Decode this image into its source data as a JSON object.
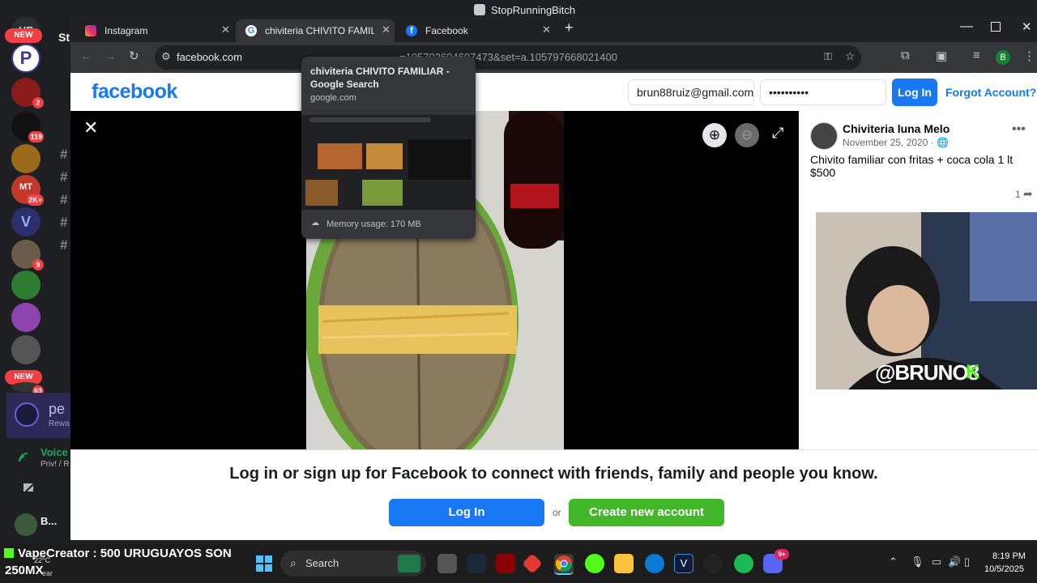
{
  "discord": {
    "badges": {
      "b2": "2",
      "b119": "119",
      "b2k": "2K+",
      "b9": "9",
      "b63": "63"
    },
    "new_pill": "NEW",
    "server_header_partial": "St",
    "channels": [
      "#",
      "#",
      "#",
      "#",
      "#"
    ],
    "panel_app_partial": "pe",
    "panel_rewards_partial": "Rewa",
    "voice_label": "Voice",
    "voice_sub": "Priv! / R",
    "user_name_partial": "B..."
  },
  "window": {
    "title": "StopRunningBitch"
  },
  "tabs": [
    {
      "label": "Instagram",
      "active": false
    },
    {
      "label": "chiviteria CHIVITO FAMILIAR - G",
      "active": true
    },
    {
      "label": "Facebook",
      "active": false
    }
  ],
  "address": {
    "host": "facebook.com",
    "path_partial": "=105703604697473&set=a.105797668021400"
  },
  "hover_card": {
    "title": "chiviteria CHIVITO FAMILIAR - Google Search",
    "domain": "google.com",
    "memory": "Memory usage: 170 MB"
  },
  "profile_initial": "B",
  "facebook": {
    "logo": "facebook",
    "email_value": "brun88ruiz@gmail.com",
    "password_value": "••••••••••",
    "login_label": "Log In",
    "forgot_label": "Forgot Account?",
    "post": {
      "author": "Chiviteria luna Melo",
      "date": "November 25, 2020 · ",
      "text": "Chivito familiar con fritas + coca cola 1 lt $500",
      "share_count": "1"
    },
    "banner_text": "Log in or sign up for Facebook to connect with friends, family and people you know.",
    "banner_login": "Log In",
    "banner_or": "or",
    "banner_create": "Create new account"
  },
  "stream": {
    "overlay_handle": "@BRUNO8",
    "ticker": "VapeCreator : 500 URUGUAYOS SON",
    "ticker_2": "250MX",
    "weather_temp": "22°C",
    "weather_sub": "ear"
  },
  "taskbar": {
    "search_label": "Search",
    "time": "8:19 PM",
    "date": "10/5/2025",
    "discord_badge": "9+"
  },
  "colors": {
    "fb_blue": "#1877f2",
    "fb_green": "#42b72a",
    "chrome_bg": "#202124",
    "discord_bg": "#1e1f22"
  }
}
